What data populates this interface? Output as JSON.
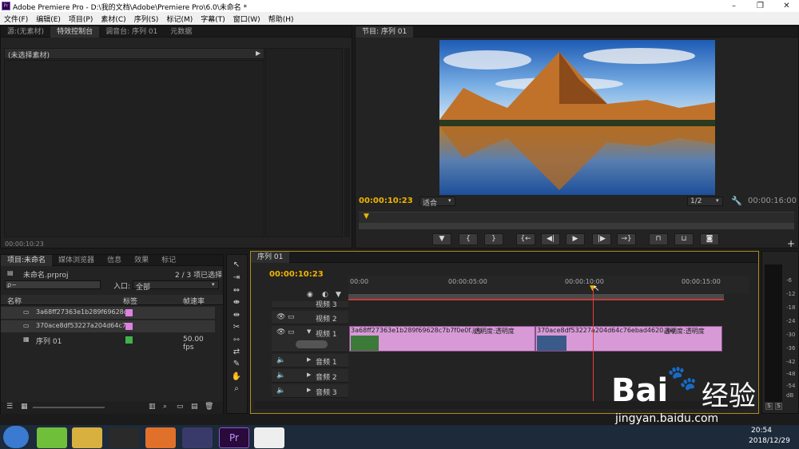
{
  "app": {
    "title": "Adobe Premiere Pro - D:\\我的文档\\Adobe\\Premiere Pro\\6.0\\未命名 *"
  },
  "menu": [
    "文件(F)",
    "编辑(E)",
    "项目(P)",
    "素材(C)",
    "序列(S)",
    "标记(M)",
    "字幕(T)",
    "窗口(W)",
    "帮助(H)"
  ],
  "source_panel": {
    "tabs": [
      "源:(无素材)",
      "特效控制台",
      "调音台: 序列 01",
      "元数据"
    ],
    "header": "(未选择素材)",
    "timecode": "00:00:10:23"
  },
  "program_monitor": {
    "tab": "节目: 序列 01",
    "timecode": "00:00:10:23",
    "fit": "适合",
    "resolution": "1/2",
    "duration": "00:00:16:00"
  },
  "project_panel": {
    "tabs": [
      "项目:未命名",
      "媒体浏览器",
      "信息",
      "效果",
      "标记"
    ],
    "file": "未命名.prproj",
    "selection": "2 / 3 项已选择",
    "search_placeholder": "ρ~",
    "in_label": "入口:",
    "in_value": "全部",
    "columns": [
      "名称",
      "标签",
      "帧速率"
    ],
    "items": [
      {
        "name": "3a68ff27363e1b289f69628c",
        "color": "#e080e0",
        "rate": ""
      },
      {
        "name": "370ace8df53227a204d64c7",
        "color": "#e080e0",
        "rate": ""
      },
      {
        "name": "序列 01",
        "color": "#3fb24a",
        "rate": "50.00 fps"
      }
    ]
  },
  "timeline": {
    "tab": "序列 01",
    "timecode": "00:00:10:23",
    "ruler": [
      "00:00",
      "00:00:05:00",
      "00:00:10:00",
      "00:00:15:00"
    ],
    "tracks": {
      "v3": "视频 3",
      "v2": "视频 2",
      "v1": "视频 1",
      "a1": "音频 1",
      "a2": "音频 2",
      "a3": "音频 3"
    },
    "clips": [
      {
        "name": "3a68ff27363e1b289f69628c7b7f0e0f.jpg",
        "fx": "透明度:透明度"
      },
      {
        "name": "370ace8df53227a204d64c76ebad4620.jpg",
        "fx": "透明度:透明度"
      }
    ]
  },
  "meter": {
    "labels": [
      "-6",
      "-12",
      "-18",
      "-24",
      "-30",
      "-36",
      "-42",
      "-48",
      "-54",
      "dB"
    ],
    "buttons": [
      "S",
      "S"
    ]
  },
  "watermark": {
    "brand": "Bai",
    "brand2": "经验",
    "url": "jingyan.baidu.com"
  },
  "taskbar": {
    "time": "20:54",
    "date": "2018/12/29",
    "pr": "Pr"
  }
}
